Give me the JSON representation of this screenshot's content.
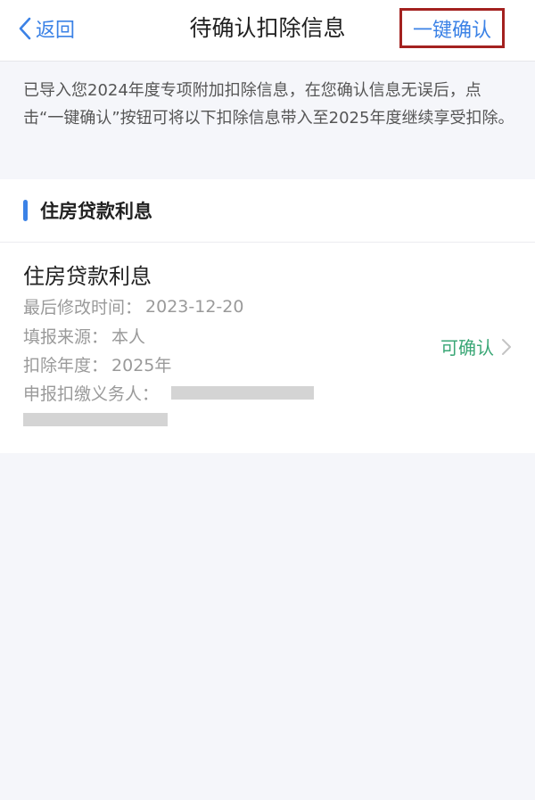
{
  "navbar": {
    "back_label": "返回",
    "title": "待确认扣除信息",
    "confirm_all_label": "一键确认"
  },
  "notice": "已导入您2024年度专项附加扣除信息，在您确认信息无误后，点击“一键确认”按钮可将以下扣除信息带入至2025年度继续享受扣除。",
  "section": {
    "title": "住房贷款利息"
  },
  "card": {
    "title": "住房贷款利息",
    "modified_label": "最后修改时间：",
    "modified_value": "2023-12-20",
    "source_label": "填报来源：",
    "source_value": "本人",
    "year_label": "扣除年度：",
    "year_value": "2025年",
    "agent_label": "申报扣缴义务人：",
    "status": "可确认"
  },
  "colors": {
    "accent": "#3b82e6",
    "status_green": "#3aa776",
    "highlight_border": "#a3211f"
  }
}
